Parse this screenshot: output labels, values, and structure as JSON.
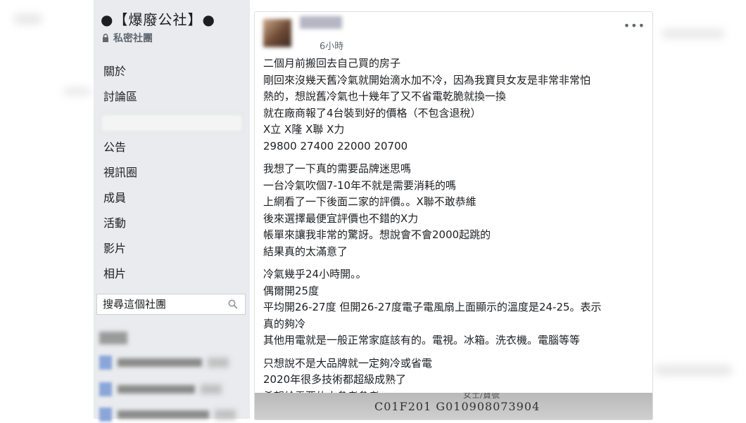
{
  "group": {
    "title": "●【爆廢公社】●",
    "privacy": "私密社團"
  },
  "nav": {
    "items": [
      "關於",
      "討論區",
      "",
      "公告",
      "視訊圈",
      "成員",
      "活動",
      "影片",
      "相片"
    ]
  },
  "search": {
    "placeholder": "搜尋這個社團"
  },
  "post": {
    "timestamp": "6小時",
    "more": "•••",
    "paragraphs": [
      [
        "二個月前搬回去自己買的房子",
        "剛回來沒幾天舊冷氣就開始滴水加不冷，因為我寶貝女友是非常非常怕",
        "熱的，想說舊冷氣也十幾年了又不省電乾脆就換一換",
        "就在廠商報了4台裝到好的價格（不包含退稅）",
        "X立 X隆 X聯 X力",
        "29800 27400 22000 20700"
      ],
      [
        "我想了一下真的需要品牌迷思嗎",
        "一台冷氣吹個7-10年不就是需要消耗的嗎",
        "上網看了一下後面二家的評價。。X聯不敢恭維",
        "後來選擇最便宜評價也不錯的X力",
        "帳單來讓我非常的驚訝。想說會不會2000起跳的",
        "結果真的太滿意了"
      ],
      [
        "冷氣幾乎24小時開。。",
        "偶爾開25度",
        "平均開26-27度 但開26-27度電子電風扇上面顯示的溫度是24-25。表示",
        "真的夠冷",
        "其他用電就是一般正常家庭該有的。電視。冰箱。洗衣機。電腦等等"
      ],
      [
        "只想說不是大品牌就一定夠冷或省電",
        "2020年很多技術都超級成熟了",
        "希望給需要的人參考參考"
      ]
    ],
    "receipt": {
      "line1": "女士/寶號",
      "line2": "C01F201  G010908073904"
    }
  },
  "colors": {
    "sidebar_bg": "#e9ebee",
    "text": "#1c1e21",
    "muted": "#606770",
    "border": "#dddfe2"
  }
}
